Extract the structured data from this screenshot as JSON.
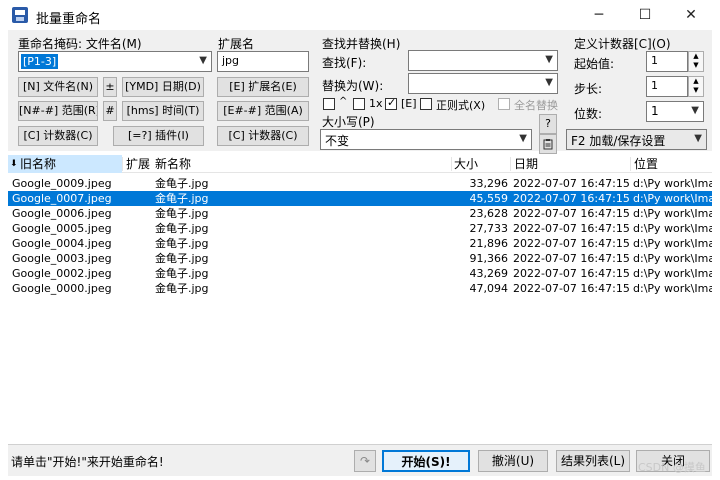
{
  "window": {
    "title": "批量重命名",
    "minimize": "─",
    "maximize": "☐",
    "close": "✕"
  },
  "mask": {
    "label": "重命名掩码: 文件名(M)",
    "value": "[P1-3]",
    "buttons": [
      "[N] 文件名(N)",
      "±",
      "[YMD] 日期(D)",
      "[N#-#] 范围(R)",
      "#",
      "[hms] 时间(T)",
      "[C] 计数器(C)",
      "[=?] 插件(I)"
    ]
  },
  "ext": {
    "label": "扩展名",
    "value": "jpg",
    "buttons": [
      "[E] 扩展名(E)",
      "[E#-#] 范围(A)",
      "[C] 计数器(C)"
    ]
  },
  "find": {
    "label": "查找并替换(H)",
    "find_label": "查找(F):",
    "replace_label": "替换为(W):",
    "opt_caret": "^",
    "opt_1x": "1x",
    "opt_e": "[E]",
    "opt_regex": "正则式(X)",
    "opt_all": "全名替换",
    "case_label": "大小写(P)",
    "case_value": "不变",
    "help": "?"
  },
  "counter": {
    "label": "定义计数器[C](O)",
    "start_label": "起始值:",
    "start_value": "1",
    "step_label": "步长:",
    "step_value": "1",
    "digits_label": "位数:",
    "digits_value": "1",
    "load_save": "F2 加载/保存设置"
  },
  "columns": [
    "旧名称",
    "扩展",
    "新名称",
    "大小",
    "日期",
    "位置"
  ],
  "rows": [
    {
      "old": "Google_0009.jpeg",
      "new": "金龟子.jpg",
      "size": "33,296",
      "date": "2022-07-07 16:47:15",
      "path": "d:\\Py work\\Imag"
    },
    {
      "old": "Google_0007.jpeg",
      "new": "金龟子.jpg",
      "size": "45,559",
      "date": "2022-07-07 16:47:15",
      "path": "d:\\Py work\\Imag"
    },
    {
      "old": "Google_0006.jpeg",
      "new": "金龟子.jpg",
      "size": "23,628",
      "date": "2022-07-07 16:47:15",
      "path": "d:\\Py work\\Imag"
    },
    {
      "old": "Google_0005.jpeg",
      "new": "金龟子.jpg",
      "size": "27,733",
      "date": "2022-07-07 16:47:15",
      "path": "d:\\Py work\\Imag"
    },
    {
      "old": "Google_0004.jpeg",
      "new": "金龟子.jpg",
      "size": "21,896",
      "date": "2022-07-07 16:47:15",
      "path": "d:\\Py work\\Imag"
    },
    {
      "old": "Google_0003.jpeg",
      "new": "金龟子.jpg",
      "size": "91,366",
      "date": "2022-07-07 16:47:15",
      "path": "d:\\Py work\\Imag"
    },
    {
      "old": "Google_0002.jpeg",
      "new": "金龟子.jpg",
      "size": "43,269",
      "date": "2022-07-07 16:47:15",
      "path": "d:\\Py work\\Imag"
    },
    {
      "old": "Google_0000.jpeg",
      "new": "金龟子.jpg",
      "size": "47,094",
      "date": "2022-07-07 16:47:15",
      "path": "d:\\Py work\\Imag"
    }
  ],
  "status": {
    "message": "请单击\"开始!\"来开始重命名!",
    "start": "开始(S)!",
    "cancel": "撤消(U)",
    "results": "结果列表(L)",
    "close": "关闭",
    "watermark": "CSDN @摸鱼"
  }
}
